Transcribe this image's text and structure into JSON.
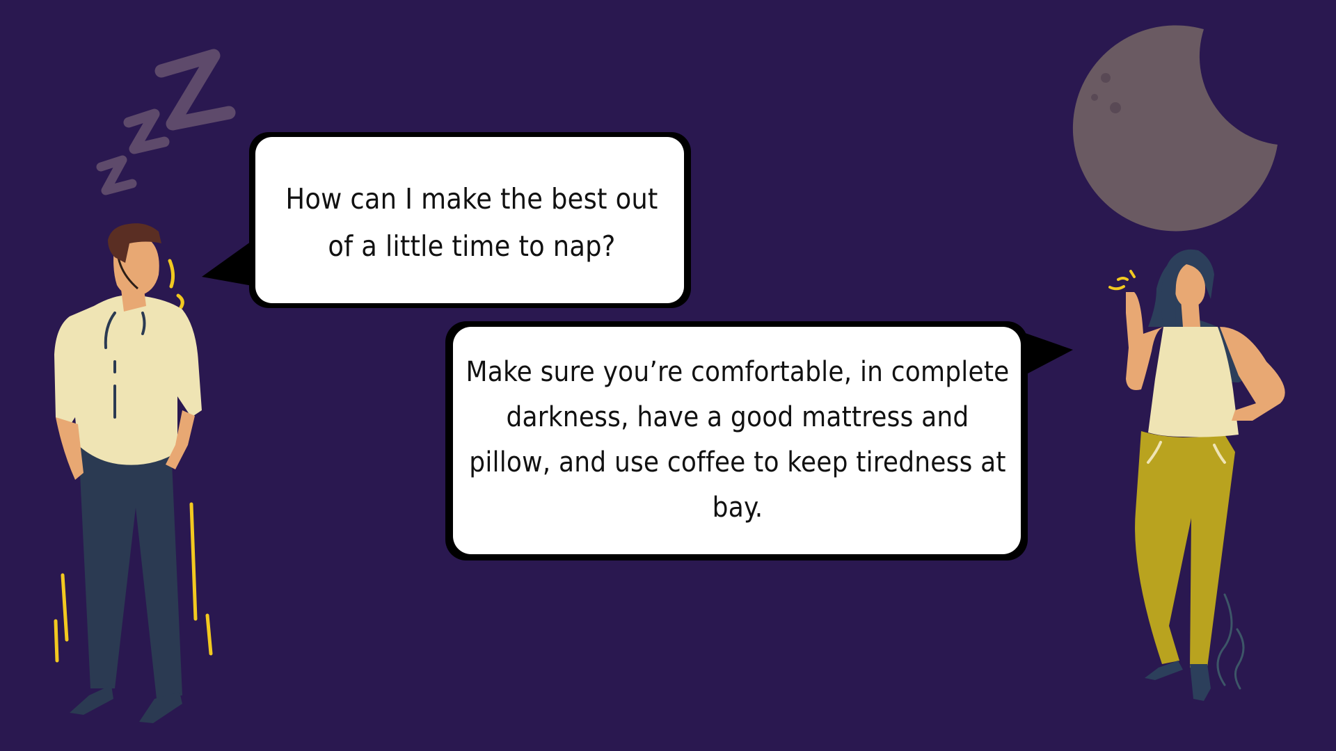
{
  "dialog": {
    "question": "How can I make the best out of a little time to nap?",
    "answer": "Make sure you’re comfortable, in complete darkness, have a good mattress and pillow, and use coffee to keep tiredness at bay."
  },
  "colors": {
    "background": "#2a1850",
    "bubble_fill": "#ffffff",
    "bubble_outline": "#000000",
    "zzz": "#5e4a6b",
    "moon": "#6a5a62",
    "accent_yellow": "#f2c920"
  },
  "icons": [
    "zzz-icon",
    "moon-icon",
    "sparkle-icon",
    "smoke-icon"
  ]
}
